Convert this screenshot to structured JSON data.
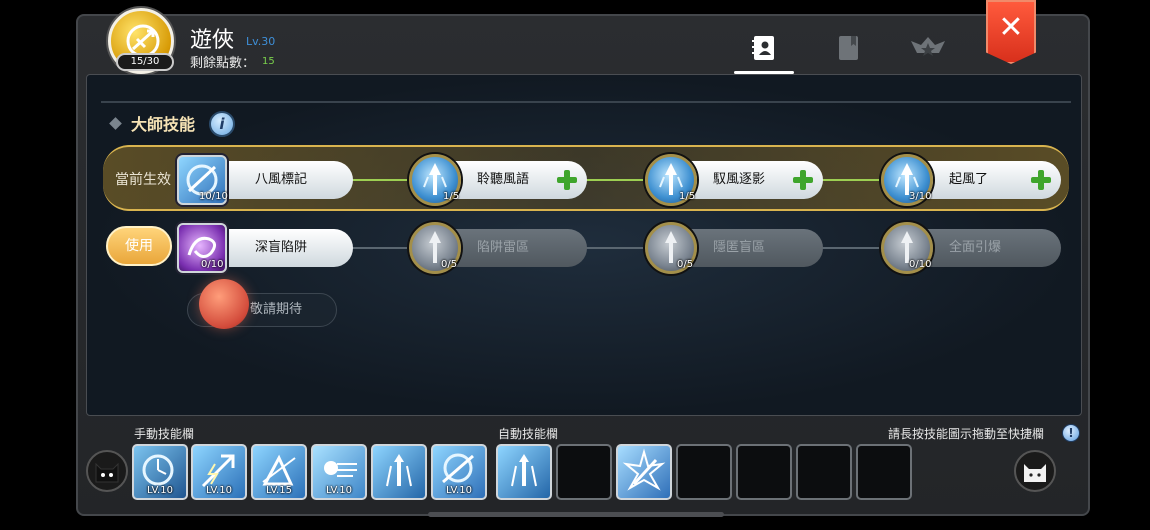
{
  "header": {
    "class_name": "遊俠",
    "level": "Lv.30",
    "points_label": "剩餘點數：",
    "points_value": "15",
    "emblem_count": "15/30",
    "tabs": [
      {
        "icon": "profile-book-icon",
        "active": true
      },
      {
        "icon": "book-icon",
        "active": false
      },
      {
        "icon": "crest-star-icon",
        "active": false
      }
    ],
    "close_label": "✕"
  },
  "panel": {
    "section_title": "大師技能",
    "info_label": "i",
    "row1": {
      "label": "當前生效",
      "skills": [
        {
          "name": "八風標記",
          "level": "10/10",
          "icon": "wind-mark-icon",
          "plus": false
        },
        {
          "name": "聆聽風語",
          "level": "1/5",
          "icon": "wind-arrow-icon",
          "plus": true
        },
        {
          "name": "馭風逐影",
          "level": "1/5",
          "icon": "wind-arrow-icon",
          "plus": true
        },
        {
          "name": "起風了",
          "level": "3/10",
          "icon": "wind-arrow-icon",
          "plus": true
        }
      ]
    },
    "row2": {
      "label": "使用",
      "skills": [
        {
          "name": "深盲陷阱",
          "level": "0/10",
          "icon": "purple-trap-icon"
        },
        {
          "name": "陷阱雷區",
          "level": "0/5",
          "icon": "wind-arrow-icon"
        },
        {
          "name": "隱匿盲區",
          "level": "0/5",
          "icon": "wind-arrow-icon"
        },
        {
          "name": "全面引爆",
          "level": "0/10",
          "icon": "wind-arrow-icon"
        }
      ]
    },
    "coming_soon": "敬請期待"
  },
  "bottom": {
    "manual_label": "手動技能欄",
    "auto_label": "自動技能欄",
    "hint": "請長按技能圖示拖動至快捷欄",
    "hint_icon": "!",
    "manual_slots": [
      {
        "icon": "clock-wind-icon",
        "level": "LV.10"
      },
      {
        "icon": "lightning-arrow-icon",
        "level": "LV.10"
      },
      {
        "icon": "triangle-arrow-icon",
        "level": "LV.15"
      },
      {
        "icon": "dash-spirit-icon",
        "level": "LV.10"
      },
      {
        "icon": "multi-arrow-icon",
        "level": ""
      },
      {
        "icon": "wind-mark-icon",
        "level": "LV.10"
      }
    ],
    "auto_slots": [
      {
        "icon": "multi-arrow-icon",
        "level": ""
      },
      {
        "icon": "",
        "level": ""
      },
      {
        "icon": "burst-arrow-icon",
        "level": ""
      },
      {
        "icon": "",
        "level": ""
      },
      {
        "icon": "",
        "level": ""
      },
      {
        "icon": "",
        "level": ""
      },
      {
        "icon": "",
        "level": ""
      }
    ]
  },
  "colors": {
    "accent_green": "#7ad04c",
    "level_blue": "#3e8fd8",
    "close_red": "#e23e24",
    "highlight_gold": "#d9b44f"
  }
}
